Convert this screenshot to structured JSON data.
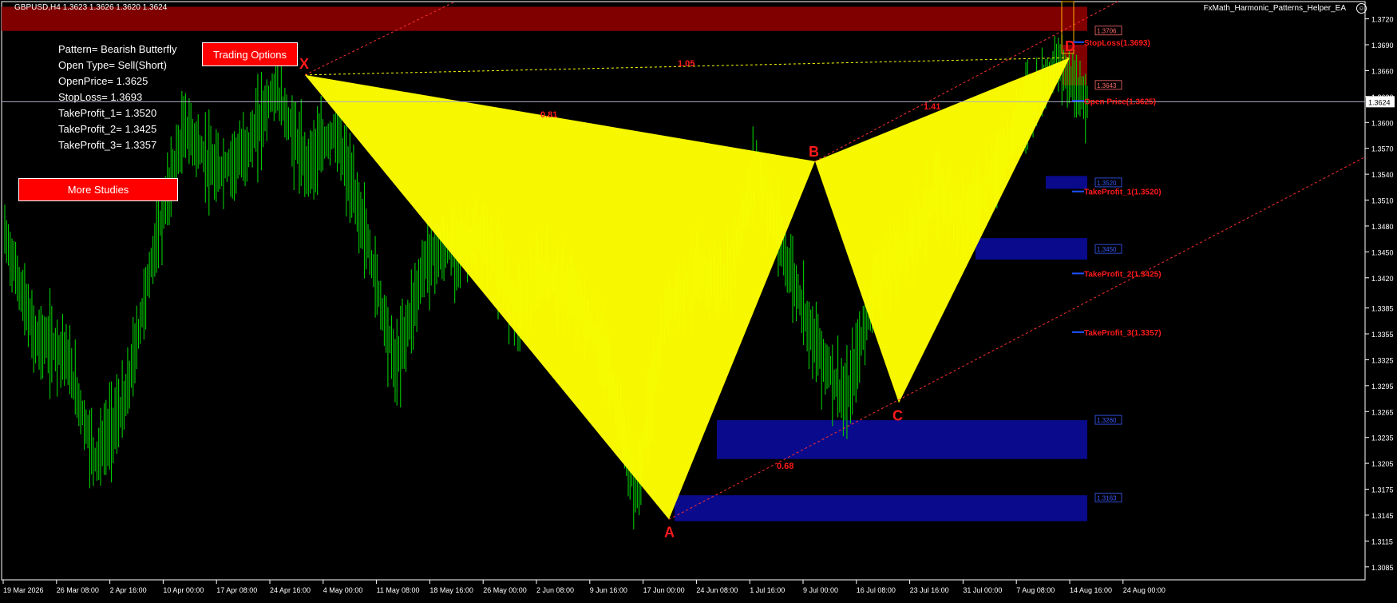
{
  "header": {
    "symbol_info": "GBPUSD,H4  1.3623 1.3626 1.3620 1.3624",
    "ea_name": "FxMath_Harmonic_Patterns_Helper_EA",
    "smiley_icon": "smiley-icon"
  },
  "info_panel": {
    "pattern": "Pattern= Bearish Butterfly",
    "open_type": "Open Type= Sell(Short)",
    "open_price": "OpenPrice= 1.3625",
    "stop_loss": "StopLoss= 1.3693",
    "tp1": "TakeProfit_1= 1.3520",
    "tp2": "TakeProfit_2= 1.3425",
    "tp3": "TakeProfit_3= 1.3357"
  },
  "buttons": {
    "trading_options": "Trading Options",
    "more_studies": "More Studies"
  },
  "colors": {
    "background": "#000000",
    "candles": "#00cc00",
    "pattern_fill": "#ffff00",
    "labels": "#ff0000",
    "stop_zone": "#800000",
    "target_zone": "#0a0a8c",
    "button": "#ff0000"
  },
  "chart_data": {
    "type": "candlestick",
    "symbol": "GBPUSD",
    "timeframe": "H4",
    "ylim": [
      1.307,
      1.374
    ],
    "y_ticks": [
      "1.3720",
      "1.3690",
      "1.3660",
      "1.3630",
      "1.3600",
      "1.3570",
      "1.3540",
      "1.3510",
      "1.3480",
      "1.3450",
      "1.3420",
      "1.3385",
      "1.3355",
      "1.3325",
      "1.3295",
      "1.3265",
      "1.3235",
      "1.3205",
      "1.3175",
      "1.3145",
      "1.3115",
      "1.3085"
    ],
    "x_ticks": [
      "19 Mar 2026",
      "26 Mar 08:00",
      "2 Apr 16:00",
      "10 Apr 00:00",
      "17 Apr 08:00",
      "24 Apr 16:00",
      "4 May 00:00",
      "11 May 08:00",
      "18 May 16:00",
      "26 May 00:00",
      "2 Jun 08:00",
      "9 Jun 16:00",
      "17 Jun 00:00",
      "24 Jun 08:00",
      "1 Jul 16:00",
      "9 Jul 00:00",
      "16 Jul 08:00",
      "23 Jul 16:00",
      "31 Jul 00:00",
      "7 Aug 08:00",
      "14 Aug 16:00",
      "24 Aug 00:00"
    ],
    "current_price": "1.3624",
    "price_path": [
      [
        1.346,
        1.348
      ],
      [
        1.33,
        1.34
      ],
      [
        1.337,
        1.33
      ],
      [
        1.325,
        1.317
      ],
      [
        1.33,
        1.325
      ],
      [
        1.342,
        1.35
      ],
      [
        1.359,
        1.36
      ],
      [
        1.356,
        1.352
      ],
      [
        1.356,
        1.357
      ],
      [
        1.362,
        1.366
      ],
      [
        1.356,
        1.354
      ],
      [
        1.36,
        1.358
      ],
      [
        1.35,
        1.344
      ],
      [
        1.332,
        1.331
      ],
      [
        1.342,
        1.346
      ],
      [
        1.348,
        1.344
      ],
      [
        1.347,
        1.346
      ],
      [
        1.34,
        1.338
      ],
      [
        1.345,
        1.34
      ],
      [
        1.336,
        1.343
      ],
      [
        1.335,
        1.33
      ],
      [
        1.32,
        1.3145
      ],
      [
        1.335,
        1.342
      ],
      [
        1.345,
        1.34
      ],
      [
        1.339,
        1.344
      ],
      [
        1.353,
        1.357
      ],
      [
        1.346,
        1.342
      ],
      [
        1.338,
        1.33
      ],
      [
        1.328,
        1.327
      ],
      [
        1.338,
        1.347
      ],
      [
        1.345,
        1.346
      ],
      [
        1.35,
        1.354
      ],
      [
        1.348,
        1.35
      ],
      [
        1.356,
        1.354
      ],
      [
        1.36,
        1.364
      ],
      [
        1.366,
        1.3675
      ],
      [
        1.363,
        1.3624
      ]
    ],
    "pattern": {
      "name": "Bearish Butterfly",
      "points": [
        {
          "label": "X",
          "price": 1.3655
        },
        {
          "label": "A",
          "price": 1.314
        },
        {
          "label": "B",
          "price": 1.3555
        },
        {
          "label": "C",
          "price": 1.3275
        },
        {
          "label": "D",
          "price": 1.3675
        }
      ],
      "ratios": [
        {
          "text": "0.81",
          "legs": "XA-AB"
        },
        {
          "text": "0.68",
          "legs": "AC"
        },
        {
          "text": "1.41",
          "legs": "BD"
        },
        {
          "text": "1.05",
          "legs": "XD"
        }
      ]
    },
    "levels": [
      {
        "label": "StopLoss(1.3693)",
        "price": 1.3693
      },
      {
        "label": "Open Price(1.3625)",
        "price": 1.3625
      },
      {
        "label": "TakeProfit_1(1.3520)",
        "price": 1.352
      },
      {
        "label": "TakeProfit_2(1.3425)",
        "price": 1.3425
      },
      {
        "label": "TakeProfit_3(1.3357)",
        "price": 1.3357
      }
    ],
    "zone_tags": [
      "1.3706",
      "1.3643",
      "1.3520",
      "1.3450",
      "1.3260",
      "1.3163"
    ]
  }
}
